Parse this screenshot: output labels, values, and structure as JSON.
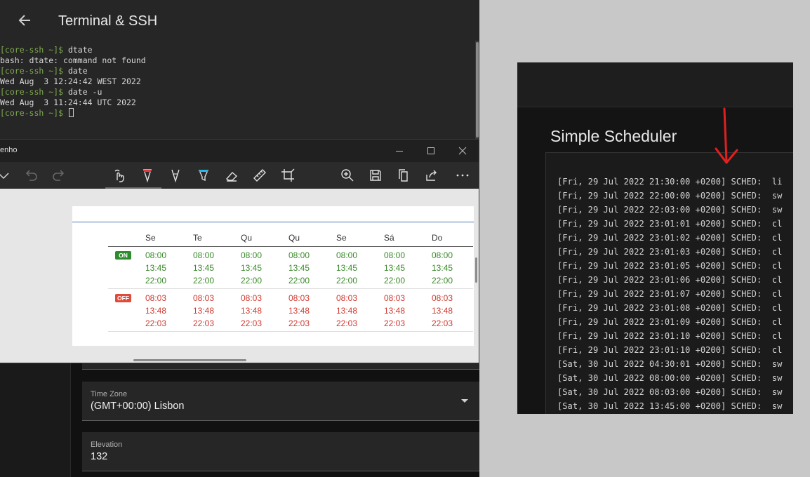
{
  "ha_panel": {
    "title": "Terminal & SSH",
    "back_icon": "arrow-left-icon",
    "terminal": {
      "lines": [
        {
          "prompt": "[core-ssh ~]$ ",
          "text": "dtate"
        },
        {
          "prompt": "",
          "text": "bash: dtate: command not found"
        },
        {
          "prompt": "[core-ssh ~]$ ",
          "text": "date"
        },
        {
          "prompt": "",
          "text": "Wed Aug  3 12:24:42 WEST 2022"
        },
        {
          "prompt": "[core-ssh ~]$ ",
          "text": "date -u"
        },
        {
          "prompt": "",
          "text": "Wed Aug  3 11:24:44 UTC 2022"
        },
        {
          "prompt": "[core-ssh ~]$ ",
          "text": ""
        }
      ]
    },
    "settings": {
      "time_zone": {
        "label": "Time Zone",
        "value": "(GMT+00:00) Lisbon"
      },
      "elevation": {
        "label": "Elevation",
        "value": "132"
      }
    }
  },
  "snip_window": {
    "title": "enho",
    "toolbar_icons": [
      "chevron-down-icon",
      "undo-icon",
      "redo-icon",
      "touch-writing-icon",
      "ballpoint-pen-icon",
      "pencil-icon",
      "highlighter-icon",
      "eraser-icon",
      "ruler-icon",
      "crop-icon",
      "zoom-in-icon",
      "save-icon",
      "copy-icon",
      "share-icon",
      "more-icon"
    ],
    "schedule": {
      "days": [
        "Se",
        "Te",
        "Qu",
        "Qu",
        "Se",
        "Sá",
        "Do"
      ],
      "on_label": "ON",
      "off_label": "OFF",
      "on_times": [
        "08:00",
        "13:45",
        "22:00"
      ],
      "off_times": [
        "08:03",
        "13:48",
        "22:03"
      ]
    }
  },
  "log_panel": {
    "title": "Simple Scheduler",
    "lines": [
      "[Fri, 29 Jul 2022 21:30:00 +0200] SCHED:  li",
      "[Fri, 29 Jul 2022 22:00:00 +0200] SCHED:  sw",
      "[Fri, 29 Jul 2022 22:03:00 +0200] SCHED:  sw",
      "[Fri, 29 Jul 2022 23:01:01 +0200] SCHED:  cl",
      "[Fri, 29 Jul 2022 23:01:02 +0200] SCHED:  cl",
      "[Fri, 29 Jul 2022 23:01:03 +0200] SCHED:  cl",
      "[Fri, 29 Jul 2022 23:01:05 +0200] SCHED:  cl",
      "[Fri, 29 Jul 2022 23:01:06 +0200] SCHED:  cl",
      "[Fri, 29 Jul 2022 23:01:07 +0200] SCHED:  cl",
      "[Fri, 29 Jul 2022 23:01:08 +0200] SCHED:  cl",
      "[Fri, 29 Jul 2022 23:01:09 +0200] SCHED:  cl",
      "[Fri, 29 Jul 2022 23:01:10 +0200] SCHED:  cl",
      "[Fri, 29 Jul 2022 23:01:10 +0200] SCHED:  cl",
      "[Sat, 30 Jul 2022 04:30:01 +0200] SCHED:  sw",
      "[Sat, 30 Jul 2022 08:00:00 +0200] SCHED:  sw",
      "[Sat, 30 Jul 2022 08:03:00 +0200] SCHED:  sw",
      "[Sat, 30 Jul 2022 13:45:00 +0200] SCHED:  sw"
    ]
  },
  "colors": {
    "prompt_green": "#7fa94f",
    "on_green": "#3a8a2a",
    "off_red": "#d03a30",
    "annotation_red": "#e02020"
  }
}
